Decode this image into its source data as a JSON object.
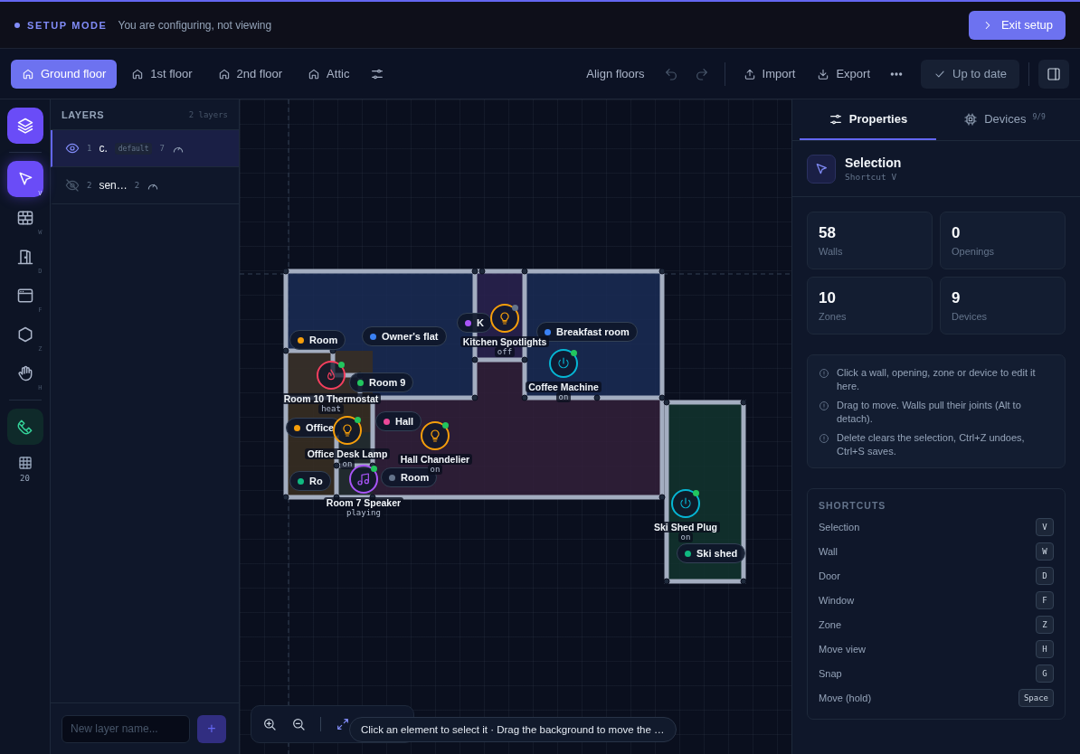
{
  "setup_bar": {
    "mode": "SETUP MODE",
    "message": "You are configuring, not viewing",
    "exit_button": "Exit setup"
  },
  "toolbar": {
    "floors": [
      {
        "label": "Ground floor",
        "selected": true
      },
      {
        "label": "1st floor",
        "selected": false
      },
      {
        "label": "2nd floor",
        "selected": false
      },
      {
        "label": "Attic",
        "selected": false
      }
    ],
    "align_button": "Align floors",
    "undo": {
      "disabled": true
    },
    "redo": {
      "disabled": true
    },
    "import_button": "Import",
    "export_button": "Export",
    "status_button": "Up to date"
  },
  "tool_rail": {
    "tools": [
      {
        "kind": "select",
        "key": "V",
        "selected": true
      },
      {
        "kind": "wall",
        "key": "W",
        "selected": false
      },
      {
        "kind": "door",
        "key": "D",
        "selected": false
      },
      {
        "kind": "window",
        "key": "F",
        "selected": false
      },
      {
        "kind": "zone",
        "key": "Z",
        "selected": false
      },
      {
        "kind": "hand",
        "key": "H",
        "selected": false
      }
    ],
    "snap": {
      "on": true
    },
    "grid": {
      "size": "20"
    }
  },
  "layers_panel": {
    "title": "LAYERS",
    "count": "2 layers",
    "layers": [
      {
        "number": "1",
        "name": "c.",
        "tag": "default",
        "devices": "7",
        "visible": true,
        "selected": true
      },
      {
        "number": "2",
        "name": "sen…",
        "devices": "2",
        "visible": false,
        "selected": false
      }
    ],
    "new_layer": {
      "placeholder": "New layer name..."
    },
    "add_button": "+"
  },
  "canvas": {
    "zones": [
      {
        "label": "K",
        "color": "#a855f7"
      },
      {
        "label": "Breakfast room",
        "color": "#3b82f6"
      },
      {
        "label": "Owner's flat",
        "color": "#3b82f6"
      },
      {
        "label": "Room",
        "color": "#f59e0b"
      },
      {
        "label": "Room 9",
        "color": "#22c55e"
      },
      {
        "label": "Office",
        "color": "#f59e0b"
      },
      {
        "label": "Room",
        "color": "#64748b"
      },
      {
        "label": "Hall",
        "color": "#ec4899"
      },
      {
        "label": "Ro",
        "color": "#10b981"
      },
      {
        "label": "Ski shed",
        "color": "#10b981"
      }
    ],
    "devices": [
      {
        "name": "Kitchen Spotlights",
        "state": "off",
        "kind": "light",
        "online": false
      },
      {
        "name": "Coffee Machine",
        "state": "on",
        "kind": "plug",
        "online": true
      },
      {
        "name": "Room 10 Thermostat",
        "state": "heat",
        "kind": "thermostat",
        "online": true
      },
      {
        "name": "Office Desk Lamp",
        "state": "on",
        "kind": "light",
        "online": true
      },
      {
        "name": "Hall Chandelier",
        "state": "on",
        "kind": "light",
        "online": true
      },
      {
        "name": "Room 7 Speaker",
        "state": "playing",
        "kind": "speaker",
        "online": true
      },
      {
        "name": "Ski Shed Plug",
        "state": "on",
        "kind": "plug",
        "online": true
      }
    ],
    "hint": "Click an element to select it · Drag the background to move the …"
  },
  "properties": {
    "tabs": [
      {
        "label": "Properties",
        "selected": true
      },
      {
        "label": "Devices",
        "badge": "9/9",
        "selected": false
      }
    ],
    "tool": {
      "title": "Selection",
      "subtitle": "Shortcut V"
    },
    "stats": [
      {
        "value": "58",
        "label": "Walls"
      },
      {
        "value": "0",
        "label": "Openings"
      },
      {
        "value": "10",
        "label": "Zones"
      },
      {
        "value": "9",
        "label": "Devices"
      }
    ],
    "tips": [
      "Click a wall, opening, zone or device to edit it here.",
      "Drag to move. Walls pull their joints (Alt to detach).",
      "Delete clears the selection, Ctrl+Z undoes, Ctrl+S saves."
    ],
    "shortcuts": {
      "title": "SHORTCUTS",
      "items": [
        {
          "action": "Selection",
          "key": "V"
        },
        {
          "action": "Wall",
          "key": "W"
        },
        {
          "action": "Door",
          "key": "D"
        },
        {
          "action": "Window",
          "key": "F"
        },
        {
          "action": "Zone",
          "key": "Z"
        },
        {
          "action": "Move view",
          "key": "H"
        },
        {
          "action": "Snap",
          "key": "G"
        },
        {
          "action": "Move (hold)",
          "key": "Space"
        }
      ]
    }
  }
}
